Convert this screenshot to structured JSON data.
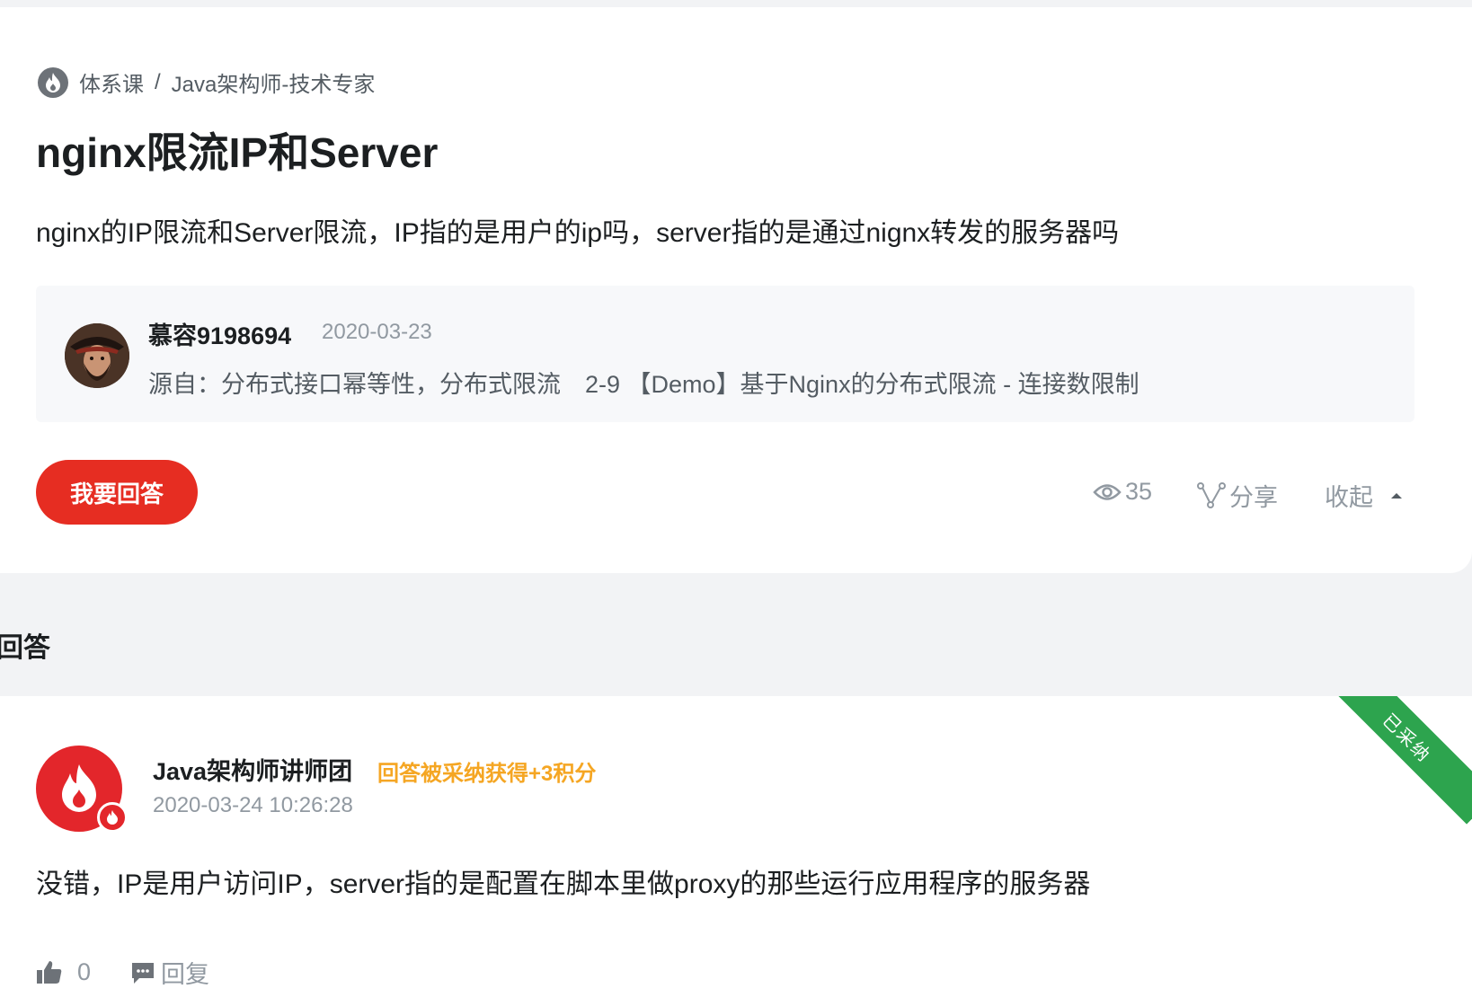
{
  "breadcrumb": {
    "category": "体系课",
    "separator": "/",
    "course": "Java架构师-技术专家"
  },
  "question": {
    "title": "nginx限流IP和Server",
    "body": "nginx的IP限流和Server限流，IP指的是用户的ip吗，server指的是通过nignx转发的服务器吗",
    "asker": {
      "name": "慕容9198694",
      "date": "2020-03-23"
    },
    "source": "源自：分布式接口幂等性，分布式限流　2-9 【Demo】基于Nginx的分布式限流 - 连接数限制"
  },
  "actions": {
    "answer_button": "我要回答",
    "views": "35",
    "share": "分享",
    "collapse": "收起"
  },
  "answers_section": {
    "heading": "回答"
  },
  "answer": {
    "accepted_label": "已采纳",
    "author": "Java架构师讲师团",
    "reward": "回答被采纳获得+3积分",
    "time": "2020-03-24 10:26:28",
    "body": "没错，IP是用户访问IP，server指的是配置在脚本里做proxy的那些运行应用程序的服务器",
    "likes": "0",
    "reply": "回复"
  },
  "colors": {
    "accent_red": "#e62d22",
    "accepted_green": "#2da44e",
    "reward_orange": "#f5a623"
  }
}
